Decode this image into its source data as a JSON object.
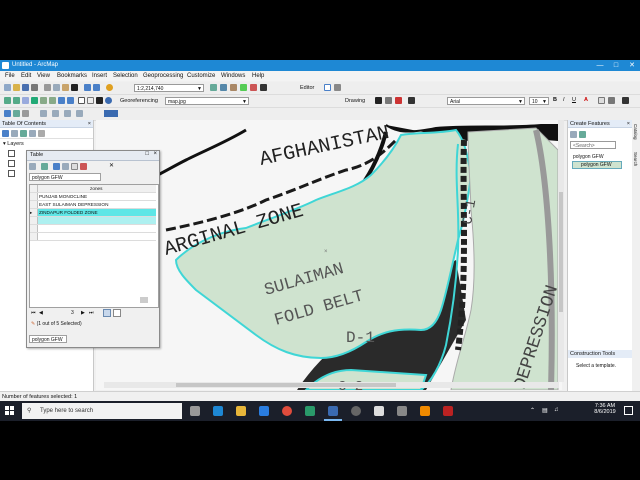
{
  "window": {
    "title": "Untitled - ArcMap"
  },
  "menu": [
    "File",
    "Edit",
    "View",
    "Bookmarks",
    "Insert",
    "Selection",
    "Geoprocessing",
    "Customize",
    "Windows",
    "Help"
  ],
  "toolbar": {
    "scale": "1:2,214,740",
    "editor_label": "Editor",
    "georef_label": "Georeferencing",
    "georef_layer": "map.jpg",
    "drawing_label": "Drawing",
    "font_name": "Arial",
    "font_size": "10",
    "bold": "B",
    "italic": "I",
    "underline": "U",
    "font_color": "A"
  },
  "toc": {
    "title": "Table Of Contents",
    "layers_label": "Layers"
  },
  "table_window": {
    "title": "Table",
    "layer_tab": "polygon GFW",
    "column": "zones",
    "rows": [
      "PUNJAB MONOCLINE",
      "EAST SULAIMAN DEPRESSION",
      "ZINDAPUR FOLDED ZONE",
      "",
      "",
      ""
    ],
    "selected_row": 2,
    "record_number": "3",
    "selection_text": "(1 out of 5 Selected)",
    "bottom_tab": "polygon GFW"
  },
  "map_labels": {
    "afghanistan": "AFGHANISTAN",
    "marginal": "ARGINAL ZONE",
    "belt_1": "SULAIMAN",
    "belt_2": "FOLD BELT",
    "d1": "D-1",
    "c1": "C-1",
    "depression": "DEPRESSION",
    "c2": "C-2"
  },
  "create_features": {
    "title": "Create Features",
    "search_placeholder": "<Search>",
    "layer_group": "polygon GFW",
    "layer_item": "polygon GFW"
  },
  "construction_tools": {
    "title": "Construction Tools",
    "hint": "Select a template."
  },
  "side_tabs": {
    "catalog": "Catalog",
    "search": "Search"
  },
  "status": {
    "text": "Number of features selected: 1"
  },
  "taskbar": {
    "search_placeholder": "Type here to search",
    "time": "7:36 AM",
    "date": "8/6/2019"
  },
  "colors": {
    "polygon_fill": "#cfe3cf",
    "selection_outline": "#3fd6d6",
    "title_bar": "#1e88d4",
    "taskbar": "#1b1f2a"
  }
}
